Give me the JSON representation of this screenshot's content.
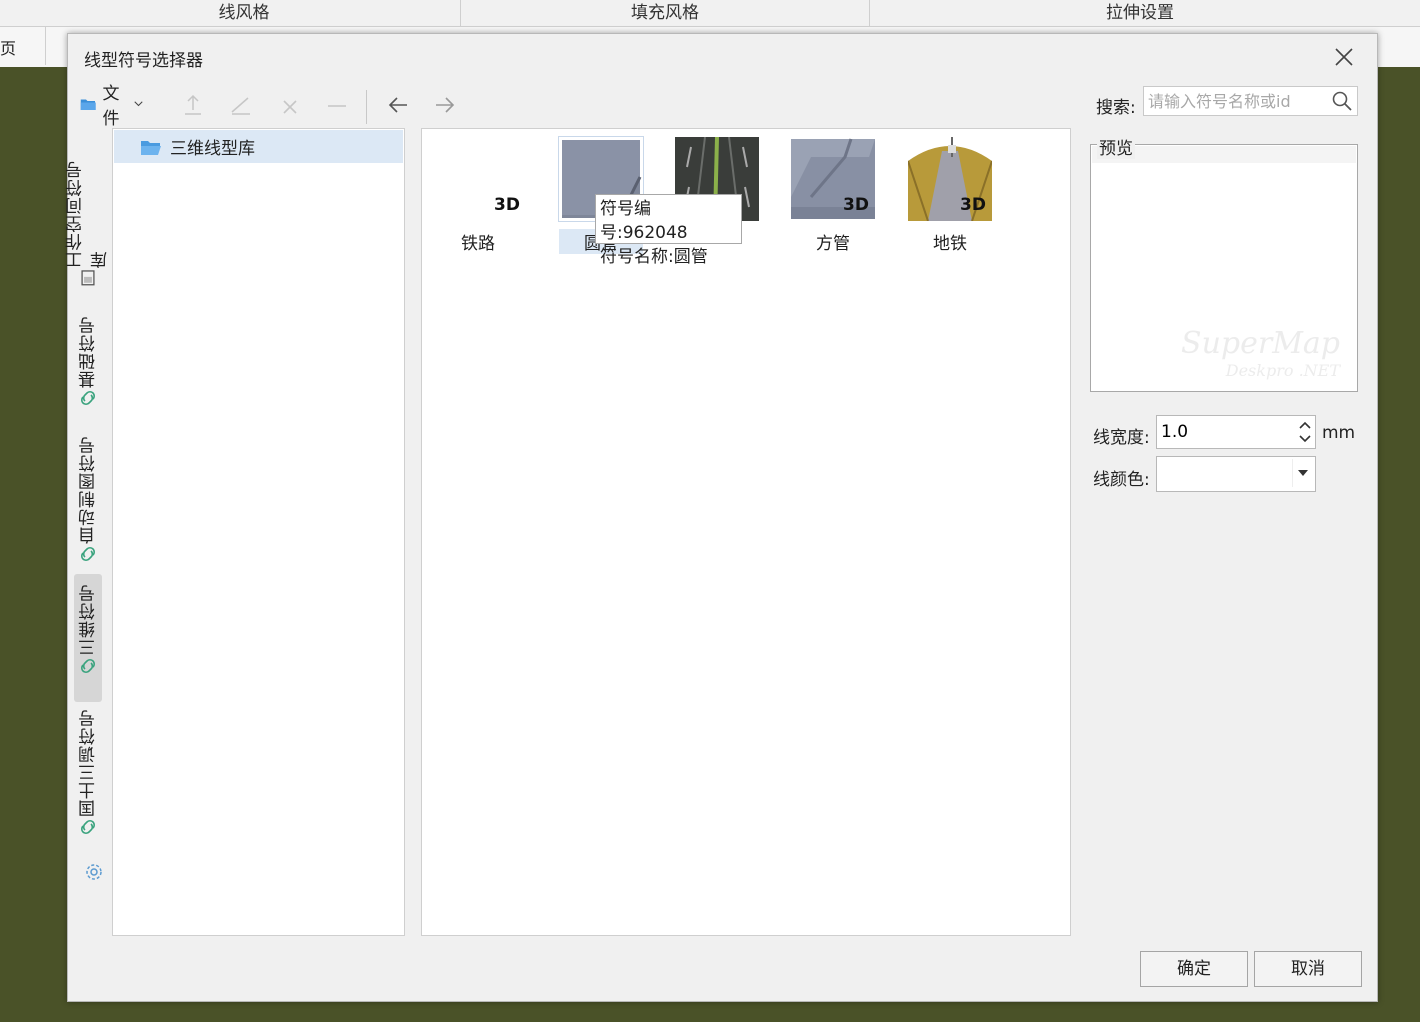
{
  "background_app": {
    "columns": [
      "线风格",
      "填充风格",
      "拉伸设置"
    ],
    "page_fragment": "页"
  },
  "dialog": {
    "title": "线型符号选择器",
    "toolbar": {
      "file_label": "文件",
      "icons": [
        "up-icon",
        "rename-icon",
        "delete-icon",
        "minus-icon",
        "back-arrow-icon",
        "forward-arrow-icon"
      ]
    },
    "search": {
      "label": "搜索:",
      "placeholder": "请输入符号名称或id"
    },
    "side_tabs": [
      {
        "label": "工作空间符号库",
        "icon": "workspace-icon"
      },
      {
        "label": "基础符号",
        "icon": "link-icon"
      },
      {
        "label": "自动制图符号",
        "icon": "link-icon"
      },
      {
        "label": "三维符号",
        "icon": "link-icon",
        "active": true
      },
      {
        "label": "国土三调符号",
        "icon": "link-icon"
      }
    ],
    "tree": {
      "selected_item": "三维线型库"
    },
    "symbols": [
      {
        "name": "铁路",
        "badge": "3D",
        "thumb": "blank"
      },
      {
        "name": "圆管",
        "badge": "",
        "thumb": "tube",
        "selected": true
      },
      {
        "name": "",
        "badge": "",
        "thumb": "road"
      },
      {
        "name": "方管",
        "badge": "3D",
        "thumb": "square-tube"
      },
      {
        "name": "地铁",
        "badge": "3D",
        "thumb": "subway"
      }
    ],
    "tooltip": {
      "line1": "符号编号:962048",
      "line2": "符号名称:圆管"
    },
    "preview": {
      "label": "预览",
      "watermark1": "SuperMap",
      "watermark2": "Deskpro .NET"
    },
    "line_width": {
      "label": "线宽度:",
      "value": "1.0",
      "unit": "mm"
    },
    "line_color": {
      "label": "线颜色:",
      "value": ""
    },
    "buttons": {
      "ok": "确定",
      "cancel": "取消"
    },
    "colors": {
      "selection": "#dce8f5",
      "desktop": "#4a5228",
      "dialog_bg": "#f0f0f0"
    }
  }
}
